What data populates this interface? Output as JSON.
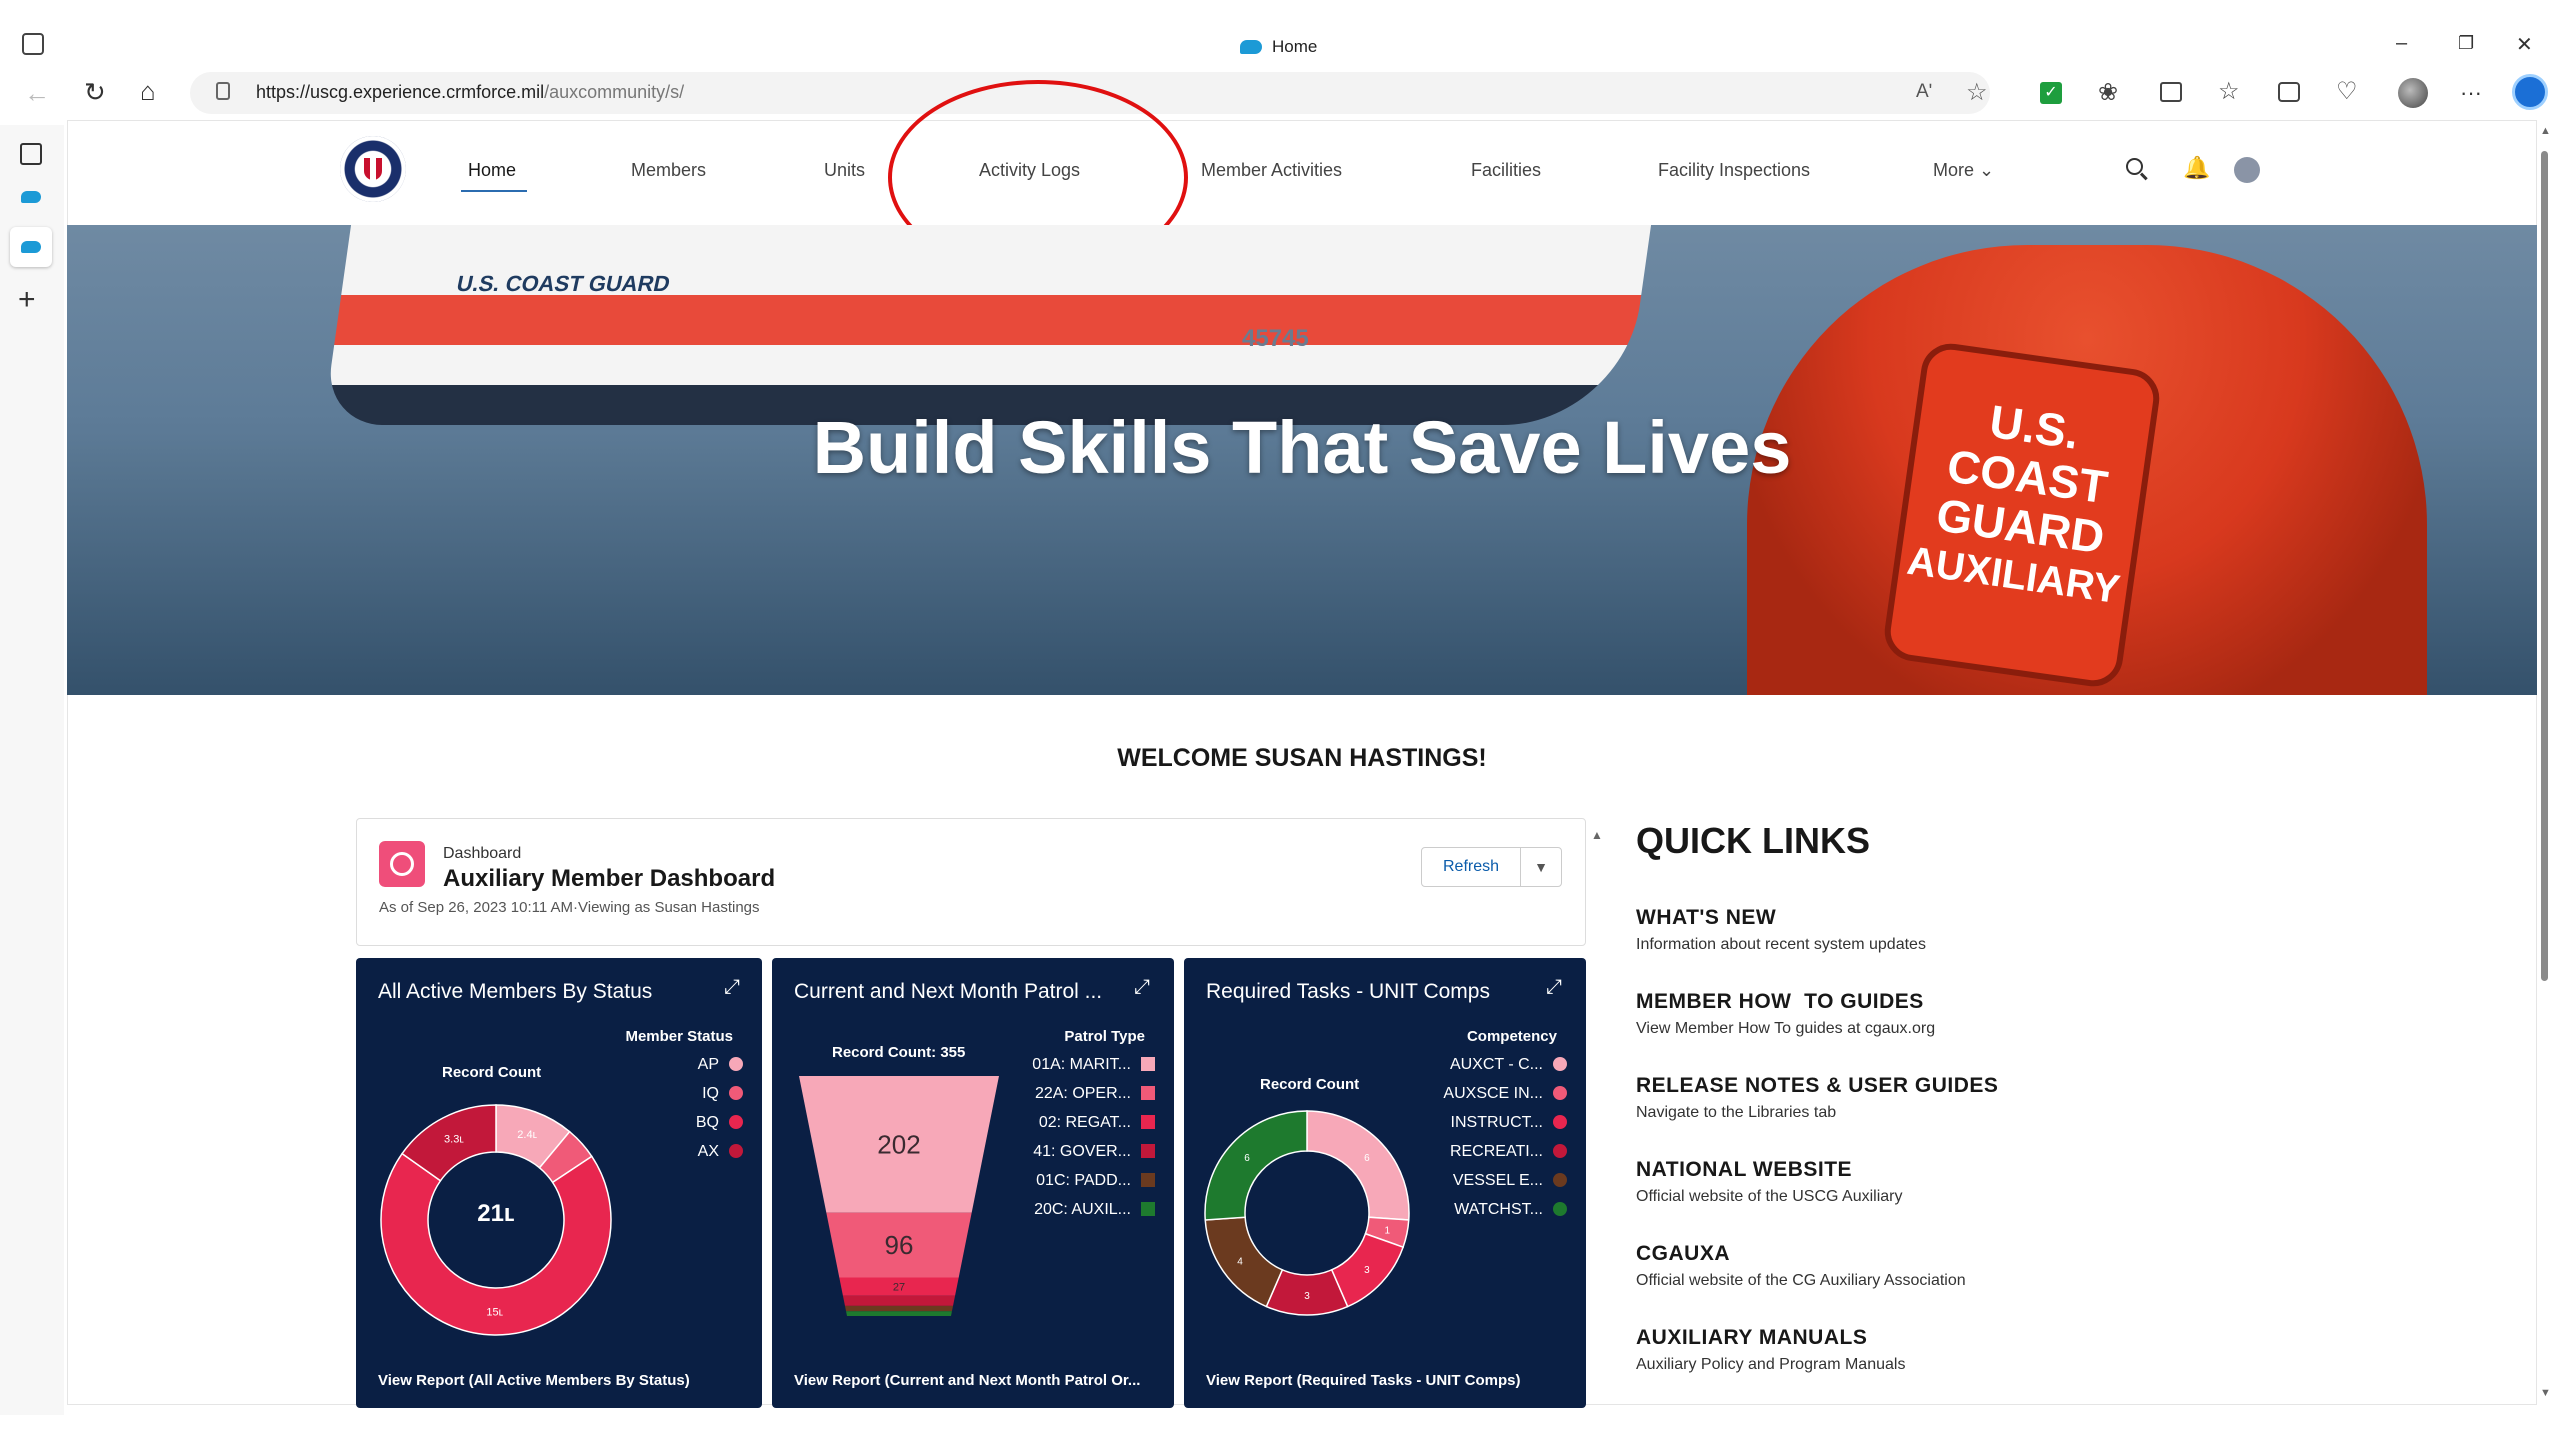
{
  "browser": {
    "tab_title": "Home",
    "url": "https://uscg.experience.crmforce.mil/auxcommunity/s/",
    "url_host": "https://uscg.experience.crmforce.mil",
    "url_path": "/auxcommunity/s/",
    "read_aloud": "Aʹ",
    "more": "···",
    "window_controls": [
      "–",
      "❐",
      "✕"
    ]
  },
  "nav": {
    "items": [
      "Home",
      "Members",
      "Units",
      "Activity Logs",
      "Member Activities",
      "Facilities",
      "Facility Inspections",
      "More"
    ],
    "active": "Home"
  },
  "hero": {
    "headline": "Build Skills That Save Lives",
    "boat_text": "U.S. COAST GUARD",
    "boat_number": "45745",
    "vest_text": [
      "U.S.",
      "COAST",
      "GUARD",
      "AUXILIARY"
    ]
  },
  "welcome": "WELCOME SUSAN HASTINGS!",
  "dashboard": {
    "label": "Dashboard",
    "title": "Auxiliary Member Dashboard",
    "asof": "As of Sep 26, 2023 10:11 AM·Viewing as Susan Hastings",
    "refresh": "Refresh"
  },
  "panels": [
    {
      "title": "All Active Members By Status",
      "legend_title": "Member Status",
      "record_label": "Record Count",
      "center": "21ʟ",
      "link": "View Report (All Active Members By Status)",
      "legend": [
        {
          "label": "AP",
          "color": "#f7a8b8"
        },
        {
          "label": "IQ",
          "color": "#f05a78"
        },
        {
          "label": "BQ",
          "color": "#e8264f"
        },
        {
          "label": "AX",
          "color": "#c2183a"
        }
      ]
    },
    {
      "title": "Current and Next Month Patrol ...",
      "legend_title": "Patrol Type",
      "record_label": "Record Count: 355",
      "link": "View Report (Current and Next Month Patrol Or...",
      "legend": [
        {
          "label": "01A: MARIT...",
          "color": "#f7a8b8"
        },
        {
          "label": "22A: OPER...",
          "color": "#f05a78"
        },
        {
          "label": "02: REGAT...",
          "color": "#e8264f"
        },
        {
          "label": "41: GOVER...",
          "color": "#c2183a"
        },
        {
          "label": "01C: PADD...",
          "color": "#6b3a1f"
        },
        {
          "label": "20C: AUXIL...",
          "color": "#1e7a2e"
        }
      ]
    },
    {
      "title": "Required Tasks - UNIT Comps",
      "legend_title": "Competency",
      "record_label": "Record Count",
      "link": "View Report (Required Tasks - UNIT Comps)",
      "legend": [
        {
          "label": "AUXCT - C...",
          "color": "#f7a8b8"
        },
        {
          "label": "AUXSCE IN...",
          "color": "#f05a78"
        },
        {
          "label": "INSTRUCT...",
          "color": "#e8264f"
        },
        {
          "label": "RECREATI...",
          "color": "#c2183a"
        },
        {
          "label": "VESSEL E...",
          "color": "#6b3a1f"
        },
        {
          "label": "WATCHST...",
          "color": "#1e7a2e"
        }
      ]
    }
  ],
  "chart_data": [
    {
      "type": "pie",
      "title": "All Active Members By Status",
      "categories": [
        "AP",
        "IQ",
        "BQ",
        "AX"
      ],
      "values": [
        2.4,
        1.0,
        15,
        3.3
      ],
      "labels": [
        "2.4ʟ",
        "",
        "15ʟ",
        "3.3ʟ"
      ],
      "total": "21ʟ"
    },
    {
      "type": "bar",
      "title": "Current and Next Month Patrol ...",
      "categories": [
        "01A: MARIT...",
        "22A: OPER...",
        "02: REGAT...",
        "41: GOVER...",
        "01C: PADD...",
        "20C: AUXIL..."
      ],
      "values": [
        202,
        96,
        27,
        15,
        8,
        7
      ],
      "labels": [
        "202",
        "96",
        "27",
        "",
        "",
        ""
      ],
      "total": 355
    },
    {
      "type": "pie",
      "title": "Required Tasks - UNIT Comps",
      "categories": [
        "AUXCT - C...",
        "AUXSCE IN...",
        "INSTRUCT...",
        "RECREATI...",
        "VESSEL E...",
        "WATCHST..."
      ],
      "values": [
        6,
        1,
        3,
        3,
        4,
        6
      ],
      "labels": [
        "6",
        "1",
        "3",
        "3",
        "4",
        "6"
      ]
    }
  ],
  "quick_links": {
    "heading": "QUICK LINKS",
    "items": [
      {
        "title": "WHAT'S NEW",
        "sub": "Information about recent system updates"
      },
      {
        "title": "MEMBER HOW  TO GUIDES",
        "sub": "View Member How To guides at cgaux.org"
      },
      {
        "title": "RELEASE NOTES & USER GUIDES",
        "sub": "Navigate to the Libraries tab"
      },
      {
        "title": "NATIONAL WEBSITE",
        "sub": "Official website of the USCG Auxiliary"
      },
      {
        "title": "CGAUXA",
        "sub": "Official website of the CG Auxiliary Association"
      },
      {
        "title": "AUXILIARY MANUALS",
        "sub": "Auxiliary Policy and Program Manuals"
      }
    ]
  },
  "colors": {
    "panel_bg": "#0a1f44",
    "annotation_circle": "#e01010",
    "nav_active_underline": "#2b6cb0"
  }
}
